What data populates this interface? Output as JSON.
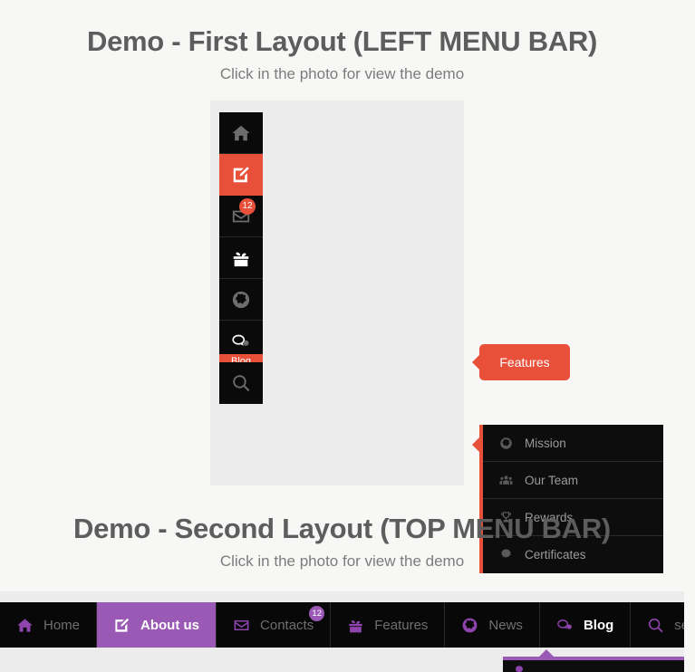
{
  "theme": {
    "page_bg": "#f7f7f6",
    "demo_bg": "#ececec",
    "accent_red": "#e8503a",
    "accent_purple": "#9b59b6",
    "menu_dark": "#0a0a0a",
    "heading_color": "#5d5d5d",
    "sub_color": "#7c7c7c"
  },
  "section_one": {
    "title": "Demo - First Layout (LEFT MENU BAR)",
    "subtitle": "Click in the photo for view the demo"
  },
  "section_two": {
    "title": "Demo - Second Layout (TOP MENU BAR)",
    "subtitle": "Click in the photo for view the demo"
  },
  "left_menu": {
    "items": [
      {
        "icon": "home-icon",
        "label": "Home",
        "active": false,
        "badge": null,
        "label_visible": false
      },
      {
        "icon": "edit-icon",
        "label": "About us",
        "active": true,
        "badge": null,
        "label_visible": false
      },
      {
        "icon": "envelope-icon",
        "label": "Contacts",
        "active": false,
        "badge": "12",
        "label_visible": false
      },
      {
        "icon": "gift-icon",
        "label": "Features",
        "active": false,
        "badge": null,
        "label_visible": false
      },
      {
        "icon": "globe-icon",
        "label": "News",
        "active": false,
        "badge": null,
        "label_visible": false
      },
      {
        "icon": "comment-icon",
        "label": "Blog",
        "active": false,
        "badge": null,
        "label_visible": true
      },
      {
        "icon": "search-icon",
        "label": "search",
        "active": false,
        "badge": null,
        "label_visible": false
      }
    ],
    "flyout": {
      "label": "Features"
    },
    "submenu": {
      "items": [
        {
          "icon": "globe-icon",
          "label": "Mission"
        },
        {
          "icon": "users-icon",
          "label": "Our Team"
        },
        {
          "icon": "trophy-icon",
          "label": "Rewards"
        },
        {
          "icon": "certificate-icon",
          "label": "Certificates"
        }
      ]
    }
  },
  "top_menu": {
    "items": [
      {
        "icon": "home-icon",
        "label": "Home",
        "state": "normal",
        "badge": null
      },
      {
        "icon": "edit-icon",
        "label": "About us",
        "state": "active",
        "badge": null
      },
      {
        "icon": "envelope-icon",
        "label": "Contacts",
        "state": "normal",
        "badge": "12"
      },
      {
        "icon": "gift-icon",
        "label": "Features",
        "state": "normal",
        "badge": null
      },
      {
        "icon": "globe-icon",
        "label": "News",
        "state": "normal",
        "badge": null
      },
      {
        "icon": "comment-icon",
        "label": "Blog",
        "state": "hover",
        "badge": null
      },
      {
        "icon": "search-icon",
        "label": "search",
        "state": "normal",
        "badge": null
      }
    ]
  }
}
